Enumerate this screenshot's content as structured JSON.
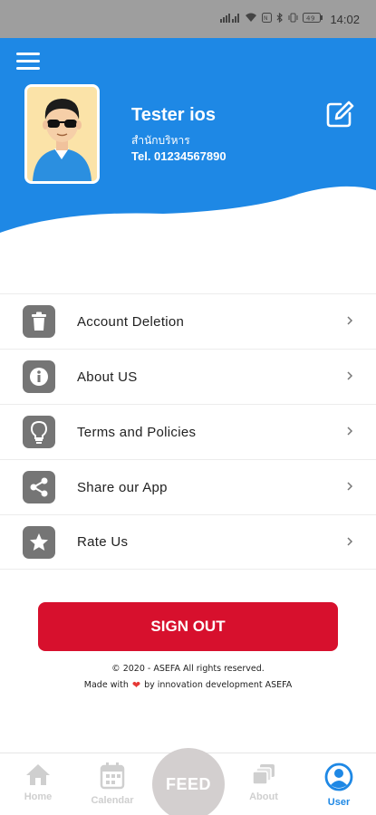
{
  "status_bar": {
    "time": "14:02",
    "icons": [
      "signal-icon",
      "wifi-icon",
      "nfc-icon",
      "bluetooth-icon",
      "vibrate-icon",
      "battery-icon"
    ]
  },
  "header": {
    "menu_icon": "hamburger-icon",
    "user": {
      "name": "Tester ios",
      "role": "สำนักบริหาร",
      "tel": "Tel. 01234567890"
    },
    "edit_icon": "edit-icon",
    "background_color": "#1e88e5"
  },
  "menu": {
    "items": [
      {
        "label": "Account Deletion",
        "icon": "trash-icon"
      },
      {
        "label": "About US",
        "icon": "info-icon"
      },
      {
        "label": "Terms and Policies",
        "icon": "lightbulb-icon"
      },
      {
        "label": "Share our App",
        "icon": "share-icon"
      },
      {
        "label": "Rate Us",
        "icon": "star-icon"
      }
    ]
  },
  "signout": {
    "label": "SIGN OUT",
    "color": "#d7102d"
  },
  "footer": {
    "copyright": "© 2020 - ASEFA All rights reserved.",
    "made_with_prefix": "Made with",
    "made_with_suffix": "by innovation development ASEFA"
  },
  "bottom_nav": {
    "items": [
      {
        "label": "Home",
        "icon": "home-icon",
        "active": false
      },
      {
        "label": "Calendar",
        "icon": "calendar-icon",
        "active": false
      },
      {
        "label": "FEED",
        "icon": "feed-button",
        "active": false
      },
      {
        "label": "About",
        "icon": "about-icon",
        "active": false
      },
      {
        "label": "User",
        "icon": "user-icon",
        "active": true
      }
    ],
    "active_color": "#1e88e5"
  }
}
